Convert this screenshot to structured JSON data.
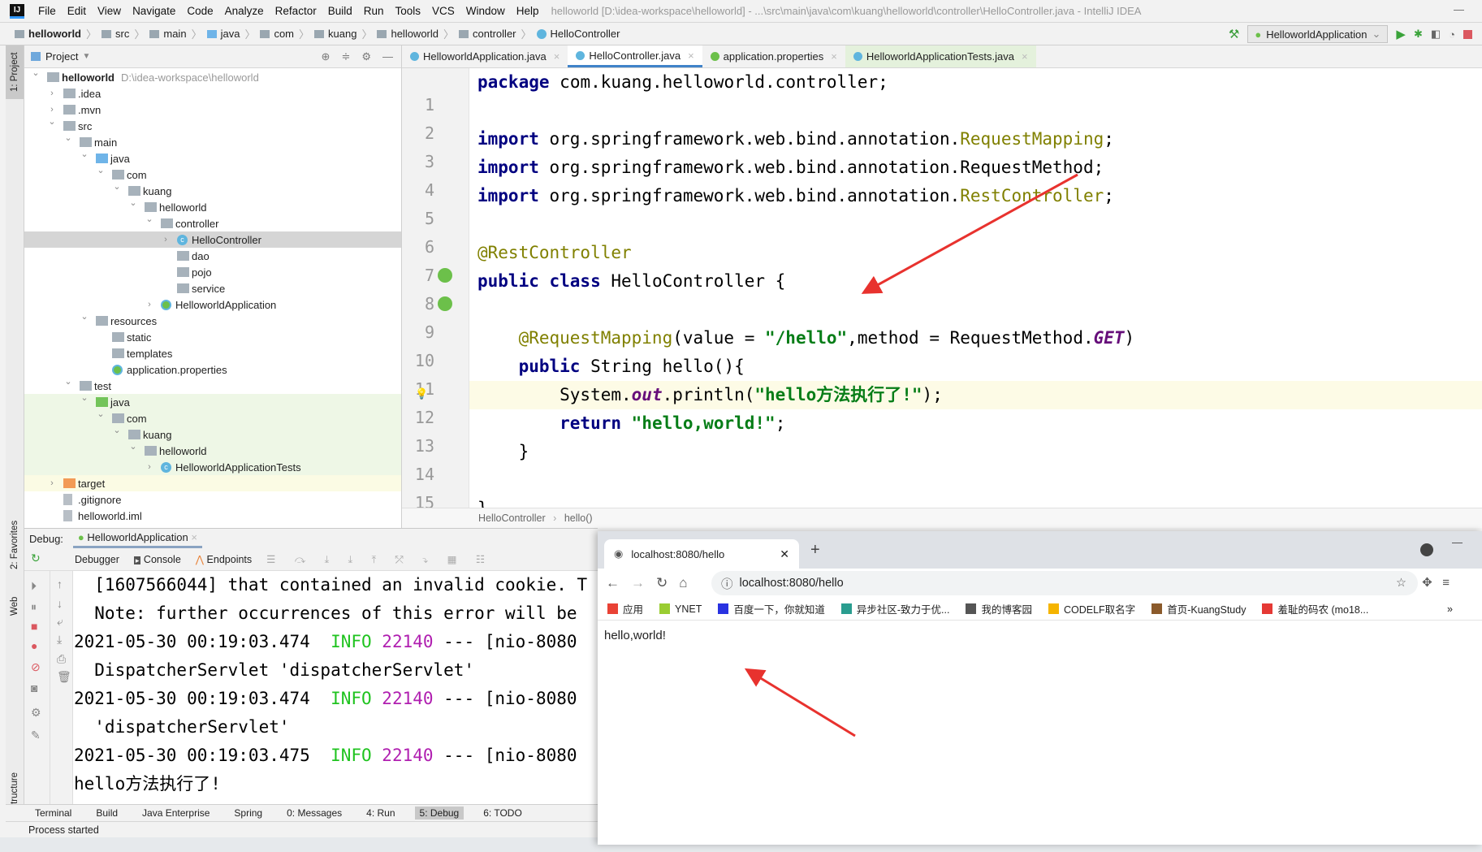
{
  "menubar": {
    "items": [
      "File",
      "Edit",
      "View",
      "Navigate",
      "Code",
      "Analyze",
      "Refactor",
      "Build",
      "Run",
      "Tools",
      "VCS",
      "Window",
      "Help"
    ],
    "window_title": "helloworld [D:\\idea-workspace\\helloworld] - ...\\src\\main\\java\\com\\kuang\\helloworld\\controller\\HelloController.java - IntelliJ IDEA",
    "logo": "IJ"
  },
  "navbar": {
    "crumbs": [
      "helloworld",
      "src",
      "main",
      "java",
      "com",
      "kuang",
      "helloworld",
      "controller",
      "HelloController"
    ],
    "run_config": "HelloworldApplication"
  },
  "left_strip": {
    "tabs": [
      "1: Project",
      "2: Favorites",
      "Web",
      "Z: Structure"
    ]
  },
  "project": {
    "title": "Project",
    "tree": [
      {
        "d": 0,
        "label": "helloworld",
        "path": "D:\\idea-workspace\\helloworld",
        "arrow": "open",
        "icon": "folder",
        "bold": true
      },
      {
        "d": 1,
        "label": ".idea",
        "arrow": "closed",
        "icon": "folder"
      },
      {
        "d": 1,
        "label": ".mvn",
        "arrow": "closed",
        "icon": "folder"
      },
      {
        "d": 1,
        "label": "src",
        "arrow": "open",
        "icon": "folder"
      },
      {
        "d": 2,
        "label": "main",
        "arrow": "open",
        "icon": "folder"
      },
      {
        "d": 3,
        "label": "java",
        "arrow": "open",
        "icon": "src"
      },
      {
        "d": 4,
        "label": "com",
        "arrow": "open",
        "icon": "folder"
      },
      {
        "d": 5,
        "label": "kuang",
        "arrow": "open",
        "icon": "folder"
      },
      {
        "d": 6,
        "label": "helloworld",
        "arrow": "open",
        "icon": "folder"
      },
      {
        "d": 7,
        "label": "controller",
        "arrow": "open",
        "icon": "folder"
      },
      {
        "d": 8,
        "label": "HelloController",
        "arrow": "closed",
        "icon": "class",
        "state": "selected"
      },
      {
        "d": 8,
        "label": "dao",
        "icon": "folder"
      },
      {
        "d": 8,
        "label": "pojo",
        "icon": "folder"
      },
      {
        "d": 8,
        "label": "service",
        "icon": "folder"
      },
      {
        "d": 7,
        "label": "HelloworldApplication",
        "arrow": "closed",
        "icon": "spring"
      },
      {
        "d": 3,
        "label": "resources",
        "arrow": "open",
        "icon": "folder"
      },
      {
        "d": 4,
        "label": "static",
        "icon": "folder"
      },
      {
        "d": 4,
        "label": "templates",
        "icon": "folder"
      },
      {
        "d": 4,
        "label": "application.properties",
        "icon": "spring"
      },
      {
        "d": 2,
        "label": "test",
        "arrow": "open",
        "icon": "folder"
      },
      {
        "d": 3,
        "label": "java",
        "arrow": "open",
        "icon": "test",
        "state": "green"
      },
      {
        "d": 4,
        "label": "com",
        "arrow": "open",
        "icon": "folder",
        "state": "green"
      },
      {
        "d": 5,
        "label": "kuang",
        "arrow": "open",
        "icon": "folder",
        "state": "green"
      },
      {
        "d": 6,
        "label": "helloworld",
        "arrow": "open",
        "icon": "folder",
        "state": "green"
      },
      {
        "d": 7,
        "label": "HelloworldApplicationTests",
        "arrow": "closed",
        "icon": "class",
        "state": "green"
      },
      {
        "d": 1,
        "label": "target",
        "arrow": "closed",
        "icon": "target",
        "state": "yellow"
      },
      {
        "d": 1,
        "label": ".gitignore",
        "icon": "file"
      },
      {
        "d": 1,
        "label": "helloworld.iml",
        "icon": "file"
      }
    ]
  },
  "editor": {
    "tabs": [
      {
        "label": "HelloworldApplication.java"
      },
      {
        "label": "HelloController.java",
        "active": true
      },
      {
        "label": "application.properties"
      },
      {
        "label": "HelloworldApplicationTests.java",
        "test": true
      }
    ],
    "highlight_line": 12,
    "lines": [
      [
        [
          "kw",
          "package"
        ],
        [
          "",
          "com.kuang.helloworld.controller;"
        ]
      ],
      [],
      [
        [
          "kw",
          "import"
        ],
        [
          "",
          "org.springframework.web.bind.annotation."
        ],
        [
          "ann",
          "RequestMapping"
        ],
        [
          "",
          ";"
        ]
      ],
      [
        [
          "kw",
          "import"
        ],
        [
          "",
          "org.springframework.web.bind.annotation.RequestMethod;"
        ]
      ],
      [
        [
          "kw",
          "import"
        ],
        [
          "",
          "org.springframework.web.bind.annotation."
        ],
        [
          "ann",
          "RestController"
        ],
        [
          "",
          ";"
        ]
      ],
      [],
      [
        [
          "ann",
          "@RestController"
        ]
      ],
      [
        [
          "kw",
          "public class"
        ],
        [
          "",
          "HelloController {"
        ]
      ],
      [],
      [
        [
          "ann",
          "    @RequestMapping"
        ],
        [
          "",
          "(value = "
        ],
        [
          "str",
          "\"/hello\""
        ],
        [
          "",
          ",method = RequestMethod."
        ],
        [
          "st",
          "GET"
        ],
        [
          "",
          ")"
        ]
      ],
      [
        [
          "kw",
          "    public"
        ],
        [
          "",
          "String hello(){"
        ]
      ],
      [
        [
          "",
          "        System."
        ],
        [
          "st",
          "out"
        ],
        [
          "",
          ".println("
        ],
        [
          "str",
          "\"hello方法执行了!\""
        ],
        [
          "",
          ");"
        ]
      ],
      [
        [
          "kw",
          "        return"
        ],
        [
          "str",
          "\"hello,world!\""
        ],
        [
          "",
          ";"
        ]
      ],
      [
        [
          "",
          "    }"
        ]
      ],
      [],
      [
        [
          "",
          "}"
        ]
      ]
    ],
    "breadcrumb": [
      "HelloController",
      "hello()"
    ]
  },
  "debug": {
    "label": "Debug:",
    "session": "HelloworldApplication",
    "tabs": [
      "Debugger",
      "Console",
      "Endpoints"
    ],
    "console": [
      [
        [
          "",
          "  [1607566044] that contained an invalid cookie. T"
        ]
      ],
      [
        [
          "",
          "  Note: further occurrences of this error will be"
        ]
      ],
      [
        [
          "",
          "2021-05-30 00:19:03.474  "
        ],
        [
          "info",
          "INFO"
        ],
        [
          "pid",
          " 22140"
        ],
        [
          "",
          " --- [nio-8080"
        ]
      ],
      [
        [
          "",
          "  DispatcherServlet 'dispatcherServlet'"
        ]
      ],
      [
        [
          "",
          "2021-05-30 00:19:03.474  "
        ],
        [
          "info",
          "INFO"
        ],
        [
          "pid",
          " 22140"
        ],
        [
          "",
          " --- [nio-8080"
        ]
      ],
      [
        [
          "",
          "  'dispatcherServlet'"
        ]
      ],
      [
        [
          "",
          "2021-05-30 00:19:03.475  "
        ],
        [
          "info",
          "INFO"
        ],
        [
          "pid",
          " 22140"
        ],
        [
          "",
          " --- [nio-8080"
        ]
      ],
      [
        [
          "",
          "hello方法执行了!"
        ]
      ]
    ]
  },
  "bottom_tabs": [
    {
      "label": "Terminal"
    },
    {
      "label": "Build"
    },
    {
      "label": "Java Enterprise"
    },
    {
      "label": "Spring"
    },
    {
      "label": "0: Messages"
    },
    {
      "label": "4: Run"
    },
    {
      "label": "5: Debug",
      "active": true
    },
    {
      "label": "6: TODO"
    }
  ],
  "status": "Process started",
  "browser": {
    "tab_title": "localhost:8080/hello",
    "url": "localhost:8080/hello",
    "bookmarks": [
      {
        "label": "应用",
        "color": "#e94235"
      },
      {
        "label": "YNET",
        "color": "#9acd32"
      },
      {
        "label": "百度一下，你就知道",
        "color": "#2932e1"
      },
      {
        "label": "异步社区-致力于优...",
        "color": "#2a9d8f"
      },
      {
        "label": "我的博客园",
        "color": "#555555"
      },
      {
        "label": "CODELF取名字",
        "color": "#f5b400"
      },
      {
        "label": "首页-KuangStudy",
        "color": "#8b5a2b"
      },
      {
        "label": "羞耻的码农 (mo18...",
        "color": "#e53935"
      }
    ],
    "more": "»",
    "content": "hello,world!"
  },
  "colors": {
    "annotation_arrow": "#e8322e",
    "keyword": "#000080",
    "string": "#067d17"
  }
}
